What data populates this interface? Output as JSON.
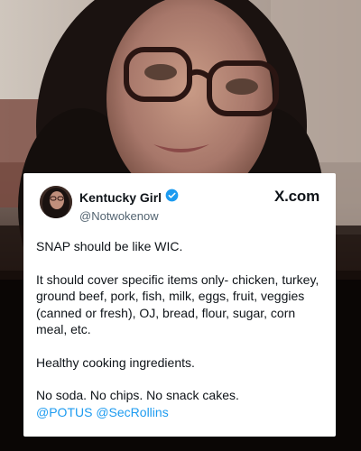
{
  "tweet": {
    "display_name": "Kentucky Girl",
    "handle": "@Notwokenow",
    "verified_color": "#1d9bf0",
    "brand": "X.com",
    "paragraphs": [
      "SNAP should be like WIC.",
      "It should cover specific items only- chicken, turkey, ground beef, pork, fish, milk, eggs, fruit, veggies (canned or fresh), OJ, bread, flour, sugar, corn meal, etc.",
      "Healthy cooking ingredients.",
      "No soda. No chips. No snack cakes."
    ],
    "mentions": [
      "@POTUS",
      "@SecRollins"
    ]
  },
  "icons": {
    "verified": "verified-badge-icon",
    "avatar": "profile-photo"
  }
}
